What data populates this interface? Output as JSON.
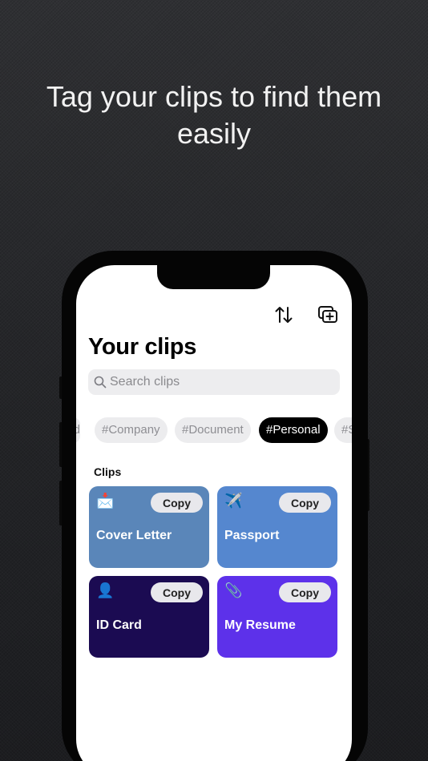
{
  "headline": "Tag your clips to find them easily",
  "app": {
    "title": "Your clips",
    "toolbar": {
      "sort_icon": "sort-arrows-icon",
      "add_icon": "add-clip-icon"
    },
    "search": {
      "placeholder": "Search clips",
      "icon": "search-icon"
    },
    "tags": [
      {
        "label": "d",
        "active": false
      },
      {
        "label": "#Company",
        "active": false
      },
      {
        "label": "#Document",
        "active": false
      },
      {
        "label": "#Personal",
        "active": true
      },
      {
        "label": "#S",
        "active": false
      }
    ],
    "section_label": "Clips",
    "clips": [
      {
        "name": "Cover Letter",
        "icon": "📩",
        "color": "#5a86b9",
        "copy_label": "Copy"
      },
      {
        "name": "Passport",
        "icon": "✈️",
        "color": "#5587cf",
        "copy_label": "Copy"
      },
      {
        "name": "ID Card",
        "icon": "👤",
        "color": "#1b0b52",
        "copy_label": "Copy"
      },
      {
        "name": "My Resume",
        "icon": "📎",
        "color": "#5d31ea",
        "copy_label": "Copy"
      }
    ]
  }
}
